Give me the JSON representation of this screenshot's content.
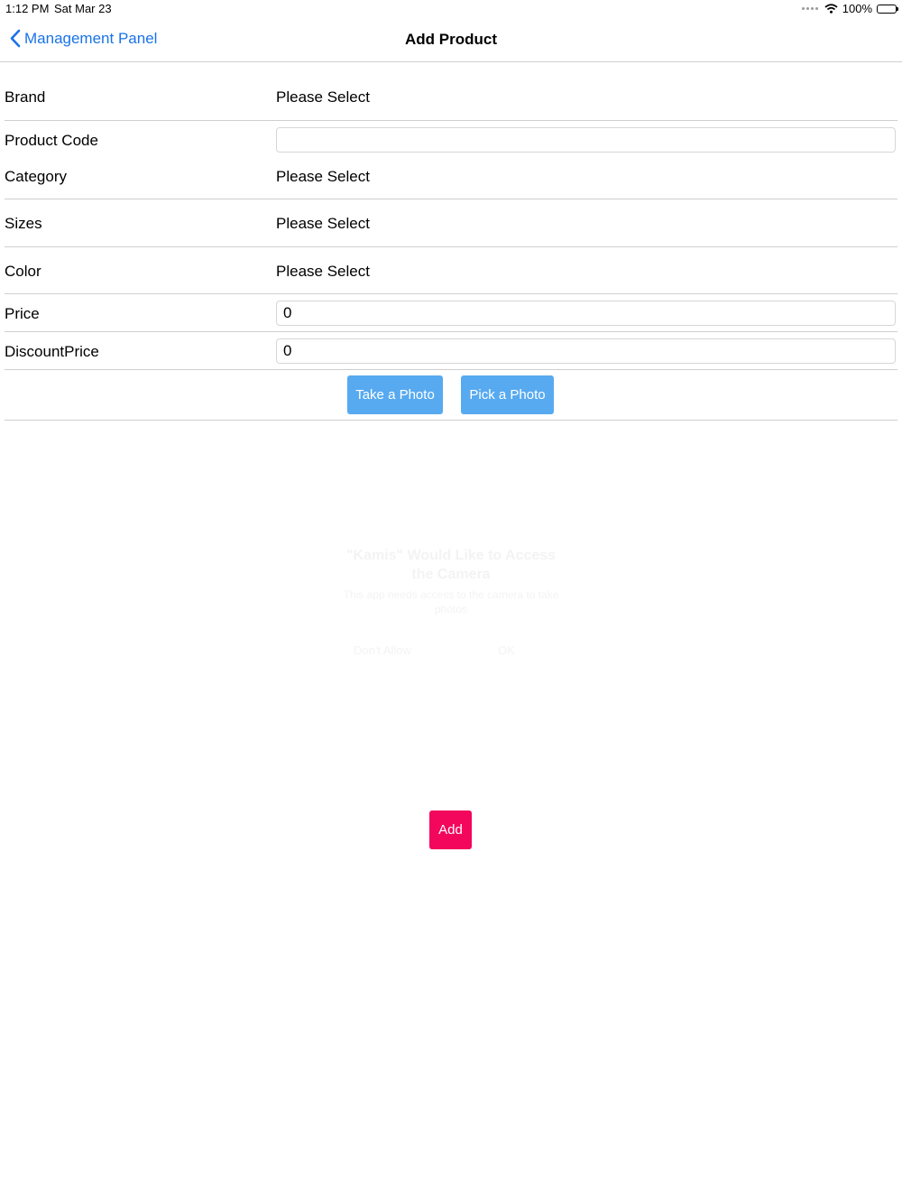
{
  "status_bar": {
    "time": "1:12 PM",
    "date": "Sat Mar 23",
    "battery": "100%"
  },
  "nav": {
    "back_label": "Management Panel",
    "title": "Add Product"
  },
  "form": {
    "brand": {
      "label": "Brand",
      "value": "Please Select"
    },
    "product_code": {
      "label": "Product Code",
      "value": ""
    },
    "category": {
      "label": "Category",
      "value": "Please Select"
    },
    "sizes": {
      "label": "Sizes",
      "value": "Please Select"
    },
    "color": {
      "label": "Color",
      "value": "Please Select"
    },
    "price": {
      "label": "Price",
      "value": "0"
    },
    "discount_price": {
      "label": "DiscountPrice",
      "value": "0"
    }
  },
  "photo_buttons": {
    "take": "Take a Photo",
    "pick": "Pick a Photo"
  },
  "add_button": "Add",
  "faded_alert": {
    "title": "\"Kamis\" Would Like to Access the Camera",
    "message": "This app needs access to the camera to take photos",
    "dont_allow": "Don't Allow",
    "ok": "OK"
  },
  "colors": {
    "link": "#1a73e8",
    "photo_button": "#57aaf0",
    "add_button": "#f2075c"
  }
}
